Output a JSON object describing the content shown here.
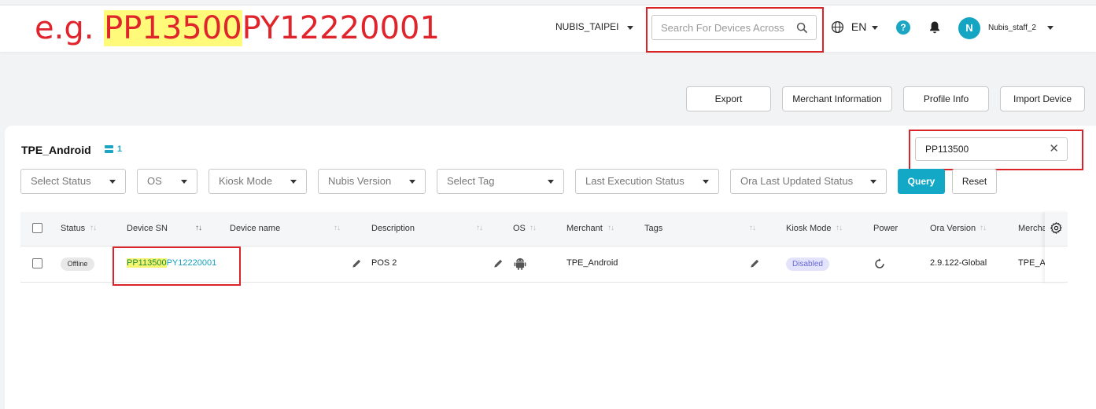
{
  "annotation": {
    "prefix": "e.g. ",
    "highlight": "PP13500",
    "suffix": "PY12220001"
  },
  "header": {
    "org": "NUBIS_TAIPEI",
    "search_placeholder": "Search For Devices Across",
    "language": "EN",
    "help": "?",
    "avatar_initial": "N",
    "username": "Nubis_staff_2"
  },
  "toolbar": {
    "export": "Export",
    "merchant_info": "Merchant Information",
    "profile_info": "Profile Info",
    "import_device": "Import Device"
  },
  "panel": {
    "title": "TPE_Android",
    "device_count": "1",
    "search_value": "PP113500",
    "filters": [
      "Select Status",
      "OS",
      "Kiosk Mode",
      "Nubis Version",
      "Select Tag",
      "Last Execution Status",
      "Ora Last Updated Status"
    ],
    "query": "Query",
    "reset": "Reset"
  },
  "table": {
    "columns": [
      "Status",
      "Device SN",
      "Device name",
      "Description",
      "OS",
      "Merchant",
      "Tags",
      "Kiosk Mode",
      "Power",
      "Ora Version",
      "Mercha"
    ],
    "rows": [
      {
        "status": "Offline",
        "sn_highlight": "PP113500",
        "sn_rest": "PY12220001",
        "device_name": "",
        "description": "POS 2",
        "os": "android",
        "merchant": "TPE_Android",
        "tags": "",
        "kiosk_mode": "Disabled",
        "ora_version": "2.9.122-Global",
        "merchant2": "TPE_A"
      }
    ]
  },
  "colors": {
    "accent": "#12a8c6",
    "annotation_red": "#d9252a",
    "highlight": "#fffa7a"
  },
  "icons": [
    "search-icon",
    "globe-icon",
    "help-icon",
    "bell-icon",
    "clear-icon",
    "gear-icon",
    "pencil-icon",
    "android-icon",
    "restart-icon",
    "server-icon"
  ]
}
